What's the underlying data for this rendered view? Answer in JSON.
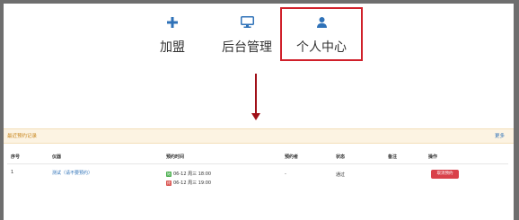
{
  "nav": {
    "items": [
      {
        "label": "加盟",
        "icon": "plus-icon"
      },
      {
        "label": "后台管理",
        "icon": "monitor-icon"
      },
      {
        "label": "个人中心",
        "icon": "user-icon"
      }
    ],
    "active_index": 2
  },
  "colors": {
    "icon_blue": "#2f72b8",
    "highlight_red": "#d0202a",
    "arrow_red": "#a01018",
    "cancel_button": "#d9414a"
  },
  "panel": {
    "title": "最近预约记录",
    "more_label": "更多",
    "columns": [
      "序号",
      "仪器",
      "预约时间",
      "预约者",
      "状态",
      "备注",
      "操作"
    ],
    "rows": [
      {
        "index": "1",
        "instrument": "测试（请不要预约）",
        "start_tag": "始",
        "start_time": "06-12 周三 18:00",
        "end_tag": "终",
        "end_time": "06-12 周三 19:00",
        "booker": "-",
        "status": "通过",
        "note": "",
        "action_label": "取消预约"
      }
    ]
  }
}
